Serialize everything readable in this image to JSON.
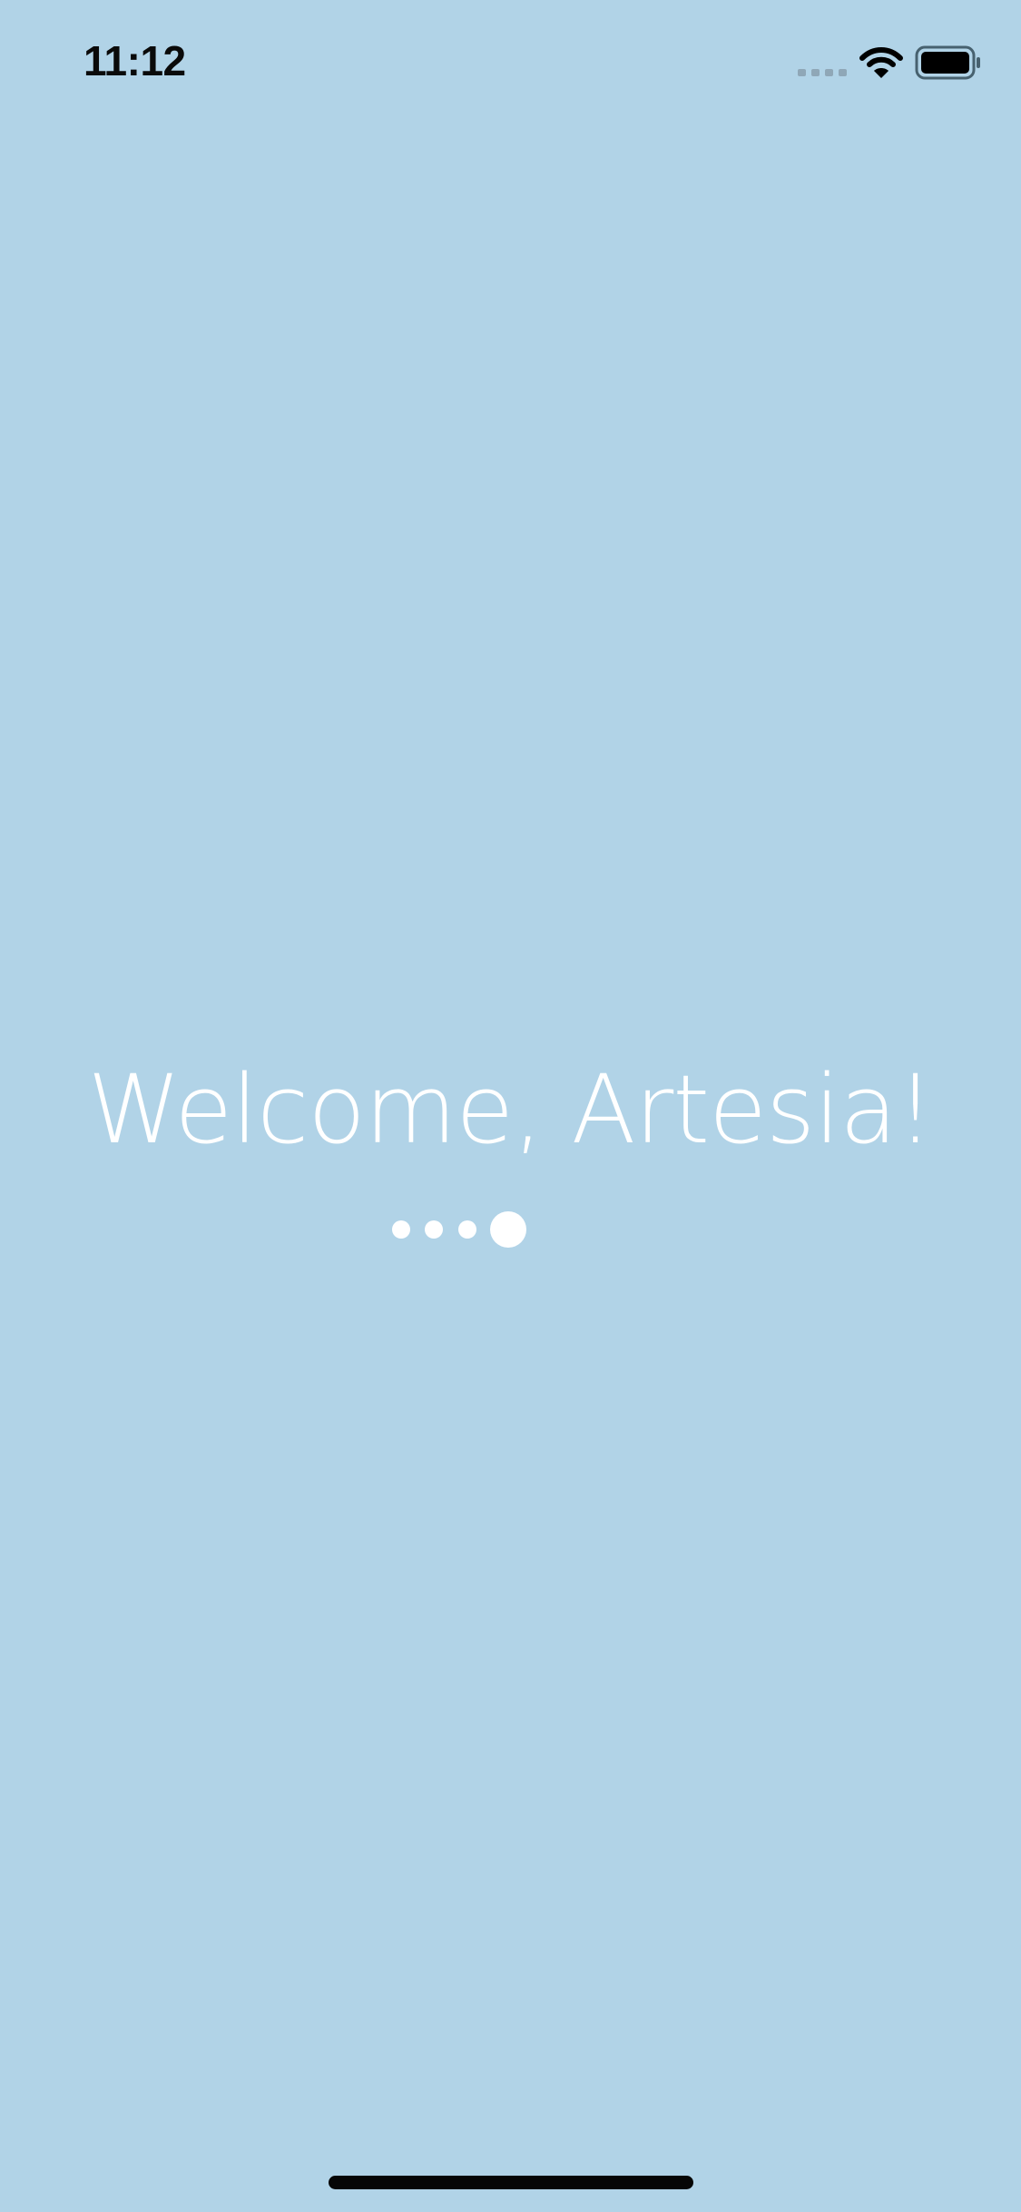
{
  "status_bar": {
    "time": "11:12",
    "signal_icon": "signal-bars-icon",
    "wifi_icon": "wifi-icon",
    "battery_icon": "battery-icon"
  },
  "welcome": {
    "title": "Welcome, Artesia!"
  },
  "loading": {
    "indicator_icon": "loading-dots-icon",
    "dot_count": 4,
    "active_dot": 4
  },
  "colors": {
    "background": "#b1d3e7",
    "text": "#ffffff",
    "status_text": "#0a0a0a",
    "home_indicator": "#060606"
  }
}
